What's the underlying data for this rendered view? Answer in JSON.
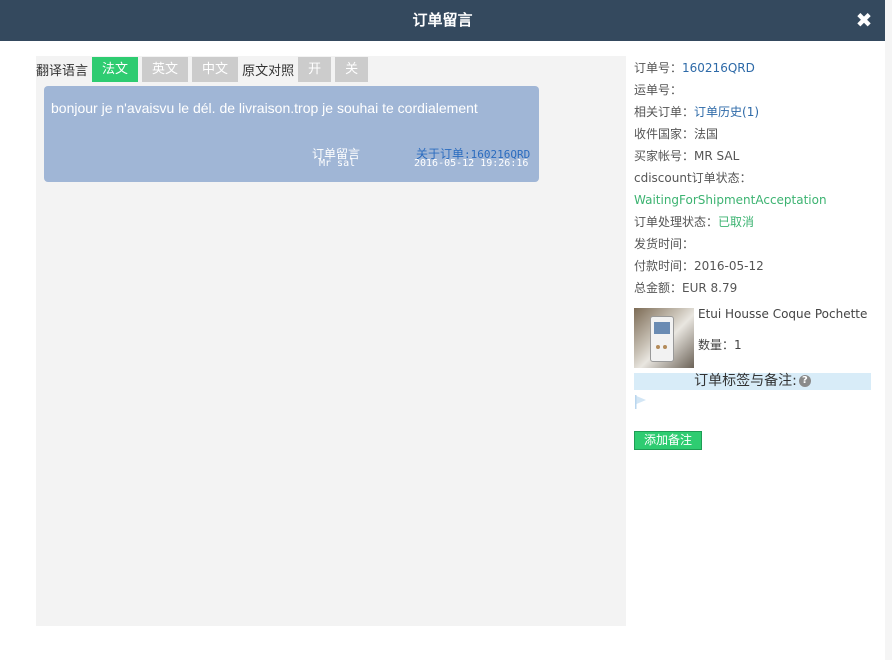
{
  "dialog": {
    "title": "订单留言",
    "close_glyph": "✖"
  },
  "toolbar": {
    "translate_label": "翻译语言",
    "lang_buttons": [
      {
        "label": "法文",
        "active": true
      },
      {
        "label": "英文",
        "active": false
      },
      {
        "label": "中文",
        "active": false
      }
    ],
    "compare_label": "原文对照",
    "toggle_buttons": [
      {
        "label": "开"
      },
      {
        "label": "关"
      }
    ]
  },
  "message": {
    "text": "bonjour je n'avaisvu le dél. de livraison.trop  je souhai  te  cordialement",
    "type_label": "订单留言",
    "sender": "Mr sal",
    "order_prefix": "关于订单",
    "order_ref": ":160216QRD",
    "timestamp": "2016-05-12 19:26:16"
  },
  "order_info": {
    "order_no_label": "订单号：",
    "order_no": "160216QRD",
    "tracking_label": "运单号：",
    "tracking": "",
    "related_label": "相关订单：",
    "related": "订单历史(1)",
    "country_label": "收件国家：",
    "country": "法国",
    "buyer_label": "买家帐号：",
    "buyer": "MR SAL",
    "platform_status_label": "cdiscount订单状态：",
    "platform_status": "WaitingForShipmentAcceptation",
    "process_status_label": "订单处理状态：",
    "process_status": "已取消",
    "ship_time_label": "发货时间：",
    "ship_time": "",
    "pay_time_label": "付款时间：",
    "pay_time": "2016-05-12",
    "total_label": "总金额：",
    "total": "EUR 8.79"
  },
  "product": {
    "name": "Etui Housse Coque Pochette",
    "qty_label": "数量：",
    "qty": "1"
  },
  "notes": {
    "heading": "订单标签与备注:",
    "help_glyph": "?",
    "add_button": "添加备注"
  },
  "colors": {
    "titlebar": "#34495e",
    "accent_green": "#2ecc71",
    "bubble": "#a0b6d6",
    "link_blue": "#2e6aa8"
  }
}
